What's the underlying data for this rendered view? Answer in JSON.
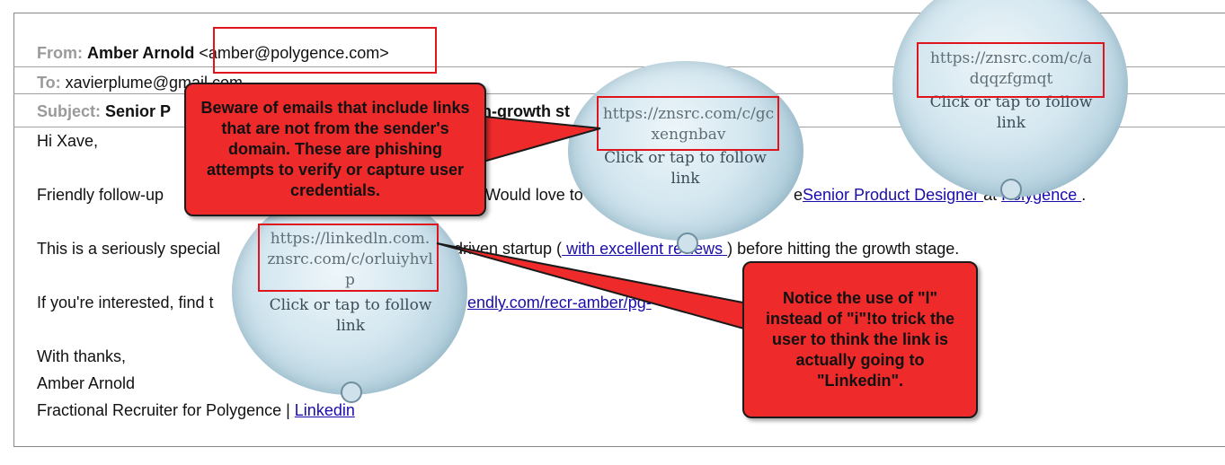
{
  "email": {
    "from_label": "From:",
    "from_name": "Amber Arnold",
    "from_address": "<amber@polygence.com>",
    "to_label": "To:",
    "to_address": "xavierplume@gmail.com",
    "subject_label": "Subject:",
    "subject_left": "Senior P",
    "subject_right": "n-growth st",
    "greeting": "Hi Xave,",
    "p1_start": "Friendly follow-up",
    "p1_mid": "Would love to",
    "p1_e": "e",
    "p1_link1": "Senior Product Designer ",
    "p1_at": "at",
    "p1_link2": "Polygence ",
    "p1_end": ".",
    "p2_start": "This is a seriously special",
    "p2_mid": "n-driven startup (",
    "p2_link": " with excellent reviews ",
    "p2_end": ") before hitting the growth stage.",
    "p3_start": "If you're interested, find t",
    "p3_link": "endly.com/recr-amber/pg-",
    "closing": "With thanks,",
    "sig_name": "Amber Arnold",
    "sig_title": "Fractional Recruiter for Polygence | ",
    "sig_link": "Linkedin"
  },
  "tooltips": [
    {
      "url": "https://znsrc.com/c/adqqzfgmqt",
      "action": "Click or tap to follow link"
    },
    {
      "url": "https://znsrc.com/c/gcxengnbav",
      "action": "Click or tap to follow link"
    },
    {
      "url": "https://linkedln.com.znsrc.com/c/orluiyhvlp",
      "action": "Click or tap to follow link"
    }
  ],
  "callouts": {
    "left": "Beware of emails that include links that are not from the sender's domain. These are phishing attempts to verify or capture user credentials.",
    "right": "Notice the use of \"l\" instead of \"i\"!to trick the user to think the link is actually going to \"Linkedin\"."
  },
  "colors": {
    "callout_red": "#ee2a2a",
    "highlight_box": "#e0141c",
    "link_blue": "#1a0dab"
  }
}
